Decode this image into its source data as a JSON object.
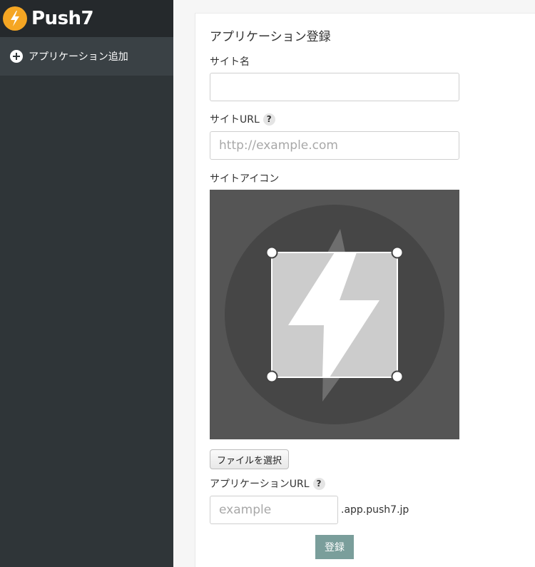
{
  "brand": {
    "name": "Push7",
    "logo_icon": "lightning-icon",
    "logo_color": "#f5a623"
  },
  "sidebar": {
    "items": [
      {
        "label": "アプリケーション追加",
        "icon": "plus-circle-icon"
      }
    ]
  },
  "form": {
    "title": "アプリケーション登録",
    "site_name": {
      "label": "サイト名",
      "value": "",
      "placeholder": ""
    },
    "site_url": {
      "label": "サイトURL",
      "help": "?",
      "value": "",
      "placeholder": "http://example.com"
    },
    "site_icon": {
      "label": "サイトアイコン",
      "preview_icon": "lightning-icon"
    },
    "file_button_label": "ファイルを選択",
    "app_url": {
      "label": "アプリケーションURL",
      "help": "?",
      "value": "",
      "placeholder": "example",
      "suffix": ".app.push7.jp"
    },
    "submit_label": "登録"
  },
  "colors": {
    "sidebar_bg": "#2f3538",
    "submit_bg": "#7a9e9b",
    "icon_bg": "#555555"
  }
}
